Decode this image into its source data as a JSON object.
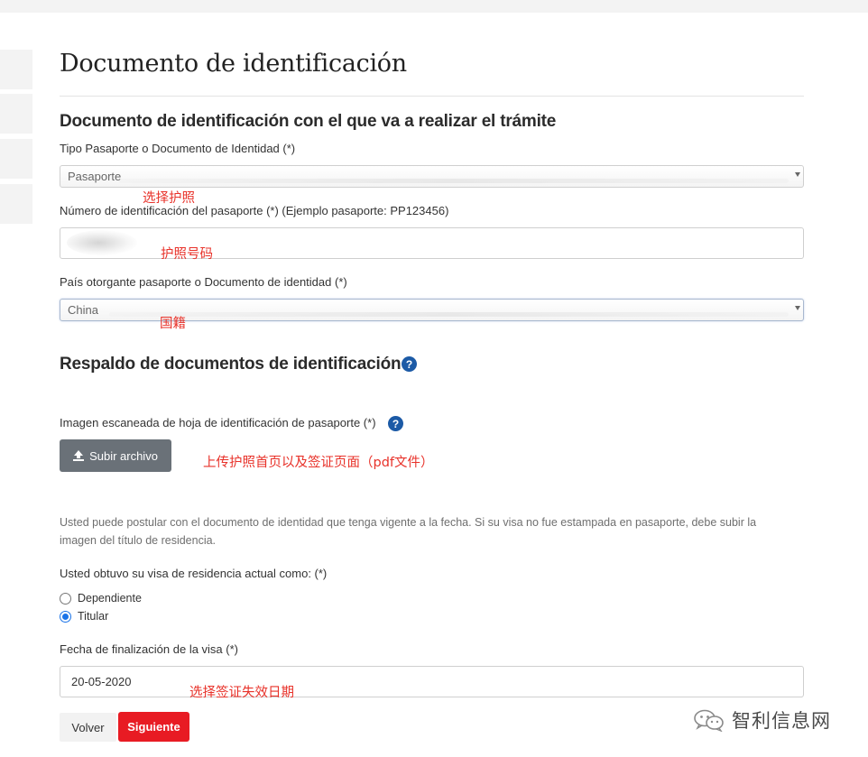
{
  "page": {
    "title": "Documento de identificación"
  },
  "section_identity": {
    "heading": "Documento de identificación con el que va a realizar el trámite",
    "doc_type_label": "Tipo Pasaporte o Documento de Identidad (*)",
    "doc_type_value": "Pasaporte",
    "passport_number_label": "Número de identificación del pasaporte (*) (Ejemplo pasaporte: PP123456)",
    "passport_number_value": "",
    "issuing_country_label": "País otorgante pasaporte o Documento de identidad (*)",
    "issuing_country_value": "China"
  },
  "section_backup": {
    "heading": "Respaldo de documentos de identificación",
    "help_glyph": "?",
    "scan_label": "Imagen escaneada de hoja de identificación de pasaporte (*)",
    "upload_button_label": "Subir archivo",
    "note": "Usted puede postular con el documento de identidad que tenga vigente a la fecha. Si su visa no fue estampada en pasaporte, debe subir la imagen del título de residencia.",
    "visa_question_label": "Usted obtuvo su visa de residencia actual como: (*)",
    "visa_options": [
      {
        "label": "Dependiente",
        "checked": false
      },
      {
        "label": "Titular",
        "checked": true
      }
    ],
    "visa_end_date_label": "Fecha de finalización de la visa (*)",
    "visa_end_date_value": "20-05-2020"
  },
  "actions": {
    "back_label": "Volver",
    "next_label": "Siguiente",
    "next_color": "#e81b23"
  },
  "annotations": {
    "select_passport": "选择护照",
    "passport_number": "护照号码",
    "nationality": "国籍",
    "upload_hint": "上传护照首页以及签证页面（pdf文件）",
    "visa_date_hint": "选择签证失效日期"
  },
  "watermark": {
    "text": "智利信息网",
    "icon": "wechat-icon"
  }
}
